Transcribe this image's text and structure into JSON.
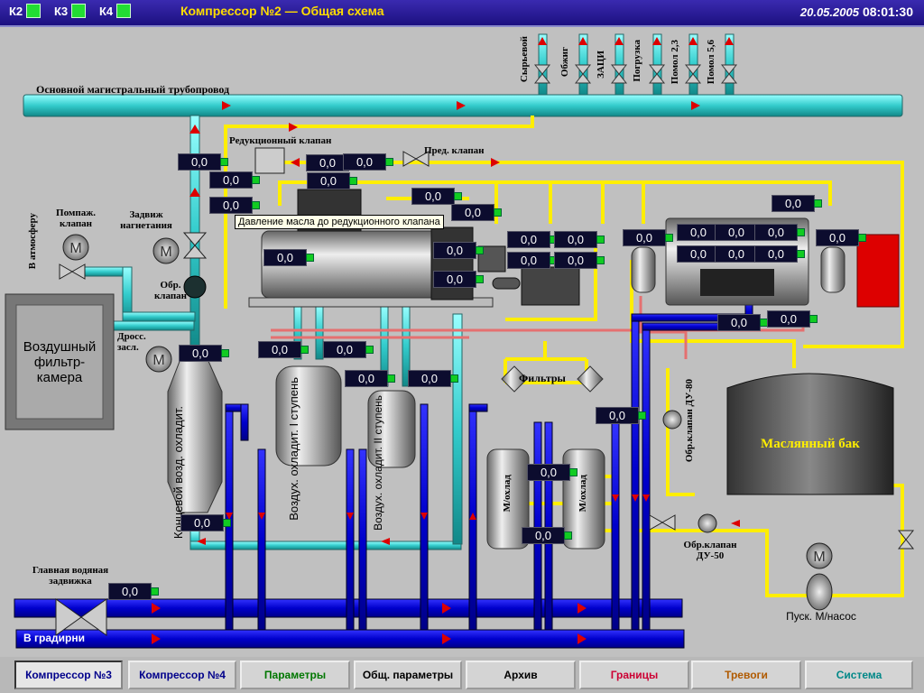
{
  "header": {
    "indicators": [
      {
        "label": "К2"
      },
      {
        "label": "К3"
      },
      {
        "label": "К4"
      }
    ],
    "title": "Компрессор №2 — Общая схема",
    "date": "20.05.2005",
    "time": "08:01:30"
  },
  "labels": {
    "main_pipe": "Основной магистральный трубопровод",
    "reduction_valve": "Редукционный клапан",
    "safety_valve": "Пред. клапан",
    "antisurge_valve": "Помпаж. клапан",
    "discharge_gate": "Задвиж нагнетания",
    "check_valve": "Обр. клапан",
    "throttle": "Дросс. засл.",
    "to_atmosphere": "В атмосферу",
    "filter": "Фильтры",
    "check_valve_80": "Обр.клапан ДУ-80",
    "check_valve_50": "Обр.клапан ДУ-50",
    "main_water_gate": "Главная водяная задвижка",
    "to_towers": "В градирни",
    "start_pump": "Пуск. М/насос"
  },
  "consumers": [
    "Сырьевой",
    "Обжиг",
    "ЗАЦИ",
    "Погрузка",
    "Помол 2,3",
    "Помол 5,6"
  ],
  "equipment": {
    "air_filter": "Воздушный фильтр-камера",
    "end_cooler": "Концевой возд. охладит.",
    "cooler1": "Воздух. охладит. I ступень",
    "cooler2": "Воздух. охладит. II ступень",
    "oil_cooler": "М/охлад",
    "oil_tank": "Маслянный бак"
  },
  "tooltip": "Давление масла до редукционного клапана",
  "values": [
    "0,0",
    "0,0",
    "0,0",
    "0,0",
    "0,0",
    "0,0",
    "0,0",
    "0,0",
    "0,0",
    "0,0",
    "0,0",
    "0,0",
    "0,0",
    "0,0",
    "0,0",
    "0,0",
    "0,0",
    "0,0",
    "0,0",
    "0,0",
    "0,0",
    "0,0",
    "0,0",
    "0,0",
    "0,0",
    "0,0",
    "0,0",
    "0,0",
    "0,0",
    "0,0",
    "0,0",
    "0,0",
    "0,0",
    "0,0",
    "0,0",
    "0,0"
  ],
  "nav": [
    {
      "label": "Компрессор №3",
      "color": "#00008b"
    },
    {
      "label": "Компрессор №4",
      "color": "#00008b"
    },
    {
      "label": "Параметры",
      "color": "#007700"
    },
    {
      "label": "Общ. параметры",
      "color": "#000000"
    },
    {
      "label": "Архив",
      "color": "#000000"
    },
    {
      "label": "Границы",
      "color": "#cc0033"
    },
    {
      "label": "Тревоги",
      "color": "#b05a00"
    },
    {
      "label": "Система",
      "color": "#008888"
    }
  ],
  "colors": {
    "air_pipe": "#3cc8c8",
    "water_pipe": "#0000cc",
    "oil_pipe": "#ffee00",
    "oil_return": "#e57070",
    "arrow": "#dd0000",
    "value_bg": "#0c0c2e",
    "indicator": "#22dd33"
  }
}
